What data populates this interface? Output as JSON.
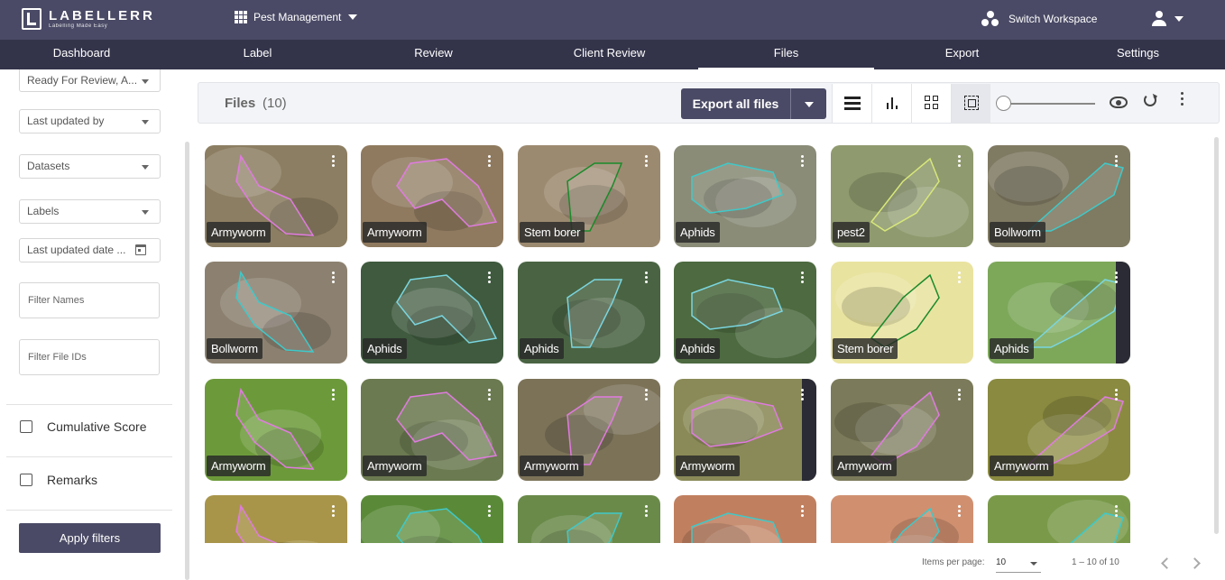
{
  "app": {
    "logo_title": "LABELLERR",
    "logo_subtitle": "Labelling Made Easy",
    "project_name": "Pest Management",
    "switch_workspace": "Switch Workspace"
  },
  "nav": {
    "items": [
      "Dashboard",
      "Label",
      "Review",
      "Client Review",
      "Files",
      "Export",
      "Settings"
    ],
    "active": "Files"
  },
  "filters": {
    "status_value": "Ready For Review, A...",
    "last_updated_by": "Last updated by",
    "datasets": "Datasets",
    "labels": "Labels",
    "last_updated_date": "Last updated date ...",
    "filter_names_placeholder": "Filter Names",
    "filter_ids_placeholder": "Filter File IDs",
    "cumulative_score": "Cumulative Score",
    "remarks": "Remarks",
    "apply_label": "Apply filters"
  },
  "header": {
    "title": "Files",
    "count": "(10)",
    "export_label": "Export all files"
  },
  "cards": [
    {
      "label": "Armyworm",
      "bg": "#8c7e62",
      "outline": "#e07be0"
    },
    {
      "label": "Armyworm",
      "bg": "#8f7a5f",
      "outline": "#e07be0"
    },
    {
      "label": "Stem borer",
      "bg": "#9c8a70",
      "outline": "#1a8a2a"
    },
    {
      "label": "Aphids",
      "bg": "#8a8c78",
      "outline": "#3fc9c9"
    },
    {
      "label": "pest2",
      "bg": "#8f9a6e",
      "outline": "#d7e87a"
    },
    {
      "label": "Bollworm",
      "bg": "#7f7a62",
      "outline": "#3fc9c9"
    },
    {
      "label": "Bollworm",
      "bg": "#8c8170",
      "outline": "#3fc9c9"
    },
    {
      "label": "Aphids",
      "bg": "#3f5a3e",
      "outline": "#7ad6e0"
    },
    {
      "label": "Aphids",
      "bg": "#4a6443",
      "outline": "#7ad6e0"
    },
    {
      "label": "Aphids",
      "bg": "#4d6a40",
      "outline": "#7ad6e0"
    },
    {
      "label": "Stem borer",
      "bg": "#e9e3a0",
      "outline": "#1a8a2a"
    },
    {
      "label": "Aphids",
      "bg": "#7da85a",
      "outline": "#7ad6e0"
    },
    {
      "label": "Armyworm",
      "bg": "#6c9a3a",
      "outline": "#e07be0"
    },
    {
      "label": "Armyworm",
      "bg": "#6b7a50",
      "outline": "#e07be0"
    },
    {
      "label": "Armyworm",
      "bg": "#7b7258",
      "outline": "#e07be0"
    },
    {
      "label": "Armyworm",
      "bg": "#8a8a58",
      "outline": "#e07be0"
    },
    {
      "label": "Armyworm",
      "bg": "#7b7a5a",
      "outline": "#e07be0"
    },
    {
      "label": "Armyworm",
      "bg": "#8a8a40",
      "outline": "#e07be0"
    },
    {
      "label": "",
      "bg": "#a8954a",
      "outline": "#e07be0"
    },
    {
      "label": "",
      "bg": "#5a8a38",
      "outline": "#3fc9c9"
    },
    {
      "label": "",
      "bg": "#6a8a4a",
      "outline": "#3fc9c9"
    },
    {
      "label": "",
      "bg": "#c08060",
      "outline": "#3fc9c9"
    },
    {
      "label": "",
      "bg": "#d09070",
      "outline": "#3fc9c9"
    },
    {
      "label": "",
      "bg": "#7a9a4a",
      "outline": "#3fc9c9"
    }
  ],
  "pagination": {
    "items_per_page_label": "Items per page:",
    "items_per_page_value": "10",
    "range": "1 – 10 of 10"
  }
}
